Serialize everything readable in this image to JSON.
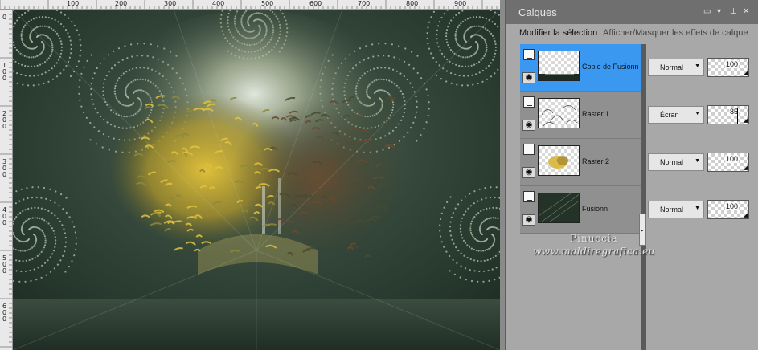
{
  "ruler": {
    "top_labels": [
      "100",
      "200",
      "300",
      "400",
      "500",
      "600",
      "700",
      "800",
      "900"
    ],
    "left_labels": [
      "0",
      "100",
      "200",
      "300",
      "400",
      "500",
      "600"
    ]
  },
  "palette": {
    "title": "Calques",
    "title_icons": [
      "window-icon",
      "dropdown-icon",
      "pin-icon",
      "close-icon"
    ],
    "toolbar": {
      "modify_selection": "Modifier la sélection",
      "toggle_effects": "Afficher/Masquer les effets de calque"
    },
    "layers": [
      {
        "name": "Copie de Fusionn",
        "blend": "Normal",
        "opacity": "100",
        "selected": true
      },
      {
        "name": "Raster 1",
        "blend": "Écran",
        "opacity": "85",
        "selected": false
      },
      {
        "name": "Raster 2",
        "blend": "Normal",
        "opacity": "100",
        "selected": false
      },
      {
        "name": "Fusionn",
        "blend": "Normal",
        "opacity": "100",
        "selected": false
      }
    ]
  },
  "watermark": {
    "line1": "Pinuccia",
    "line2": "www.maldiregrafica.eu"
  },
  "colors": {
    "selected_layer": "#3a98f0",
    "palette_bg": "#a8a8a8",
    "title_bar": "#6f6f6f"
  }
}
